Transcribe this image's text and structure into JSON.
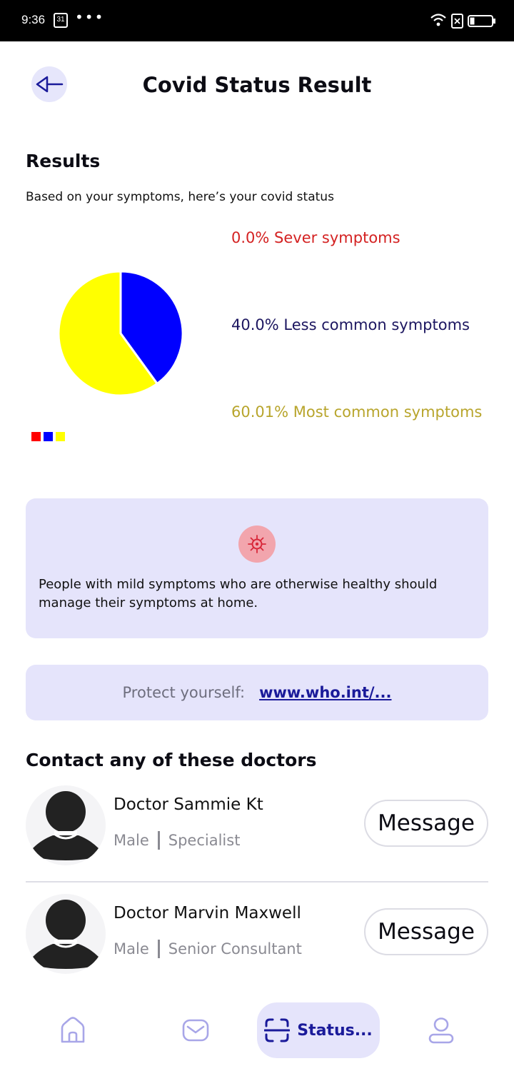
{
  "status_bar": {
    "time": "9:36",
    "calendar_day": "31",
    "dots": "•••"
  },
  "header": {
    "title": "Covid Status Result"
  },
  "results": {
    "heading": "Results",
    "subtitle": "Based on your symptoms, here’s your covid status"
  },
  "chart_data": {
    "type": "pie",
    "series": [
      {
        "name": "Sever symptoms",
        "value": 0.0,
        "color": "#ff0000",
        "label": "0.0% Sever symptoms",
        "label_color": "#d42222"
      },
      {
        "name": "Less common symptoms",
        "value": 40.0,
        "color": "#0000ff",
        "label": "40.0% Less common symptoms",
        "label_color": "#1c1660"
      },
      {
        "name": "Most common symptoms",
        "value": 60.01,
        "color": "#ffff00",
        "label": "60.01% Most common symptoms",
        "label_color": "#b8a52c"
      }
    ]
  },
  "info_card": {
    "icon": "virus-icon",
    "text": "People with mild  symptoms who are otherwise healthy should manage their symptoms at home."
  },
  "protect": {
    "label": "Protect yourself:",
    "link": "www.who.int/..."
  },
  "doctors": {
    "heading": "Contact any of these doctors",
    "items": [
      {
        "name": "Doctor Sammie Kt",
        "gender": "Male",
        "role": "Specialist",
        "button": "Message"
      },
      {
        "name": "Doctor Marvin Maxwell",
        "gender": "Male",
        "role": "Senior Consultant",
        "button": "Message"
      }
    ]
  },
  "nav": {
    "items": [
      {
        "icon": "home-icon"
      },
      {
        "icon": "mail-icon"
      },
      {
        "icon": "scan-icon",
        "label": "Status..."
      },
      {
        "icon": "user-icon"
      }
    ],
    "accent": "#1a1a9a",
    "inactive_color": "#a8a6e8"
  }
}
